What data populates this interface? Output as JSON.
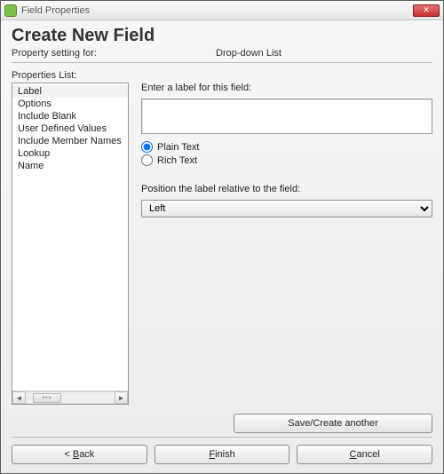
{
  "window": {
    "title": "Field Properties"
  },
  "header": {
    "title": "Create New Field",
    "setting_for_label": "Property setting for:",
    "field_type": "Drop-down List"
  },
  "properties_list": {
    "label": "Properties List:",
    "items": [
      {
        "label": "Label",
        "selected": true
      },
      {
        "label": "Options",
        "selected": false
      },
      {
        "label": "Include Blank",
        "selected": false
      },
      {
        "label": "User Defined Values",
        "selected": false
      },
      {
        "label": "Include Member Names",
        "selected": false
      },
      {
        "label": "Lookup",
        "selected": false
      },
      {
        "label": "Name",
        "selected": false
      }
    ]
  },
  "panel": {
    "enter_label": "Enter a label for this field:",
    "label_value": "",
    "radio_plain": "Plain Text",
    "radio_rich": "Rich Text",
    "text_mode": "plain",
    "position_label": "Position the label relative to the field:",
    "position_value": "Left"
  },
  "buttons": {
    "save_create": "Save/Create another",
    "back_pre": "< ",
    "back_hot": "B",
    "back_post": "ack",
    "finish_pre": "",
    "finish_hot": "F",
    "finish_post": "inish",
    "cancel_pre": "",
    "cancel_hot": "C",
    "cancel_post": "ancel"
  }
}
